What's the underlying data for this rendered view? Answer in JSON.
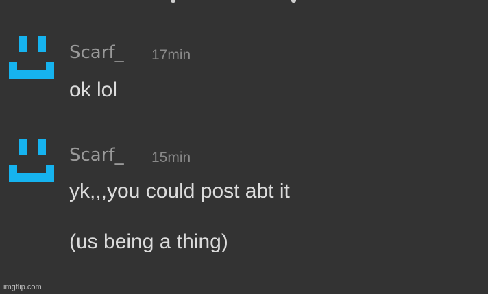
{
  "colors": {
    "background": "#333333",
    "avatar": "#16b3ef",
    "username": "#9a9a9a",
    "timestamp": "#8a8a8a",
    "message_text": "#dcdcdc"
  },
  "messages": [
    {
      "avatar_icon": "smiley-pixel-avatar-icon",
      "username": "Scarf_",
      "time": "17min",
      "lines": [
        "ok lol"
      ]
    },
    {
      "avatar_icon": "smiley-pixel-avatar-icon",
      "username": "Scarf_",
      "time": "15min",
      "lines": [
        "yk,,,you could post abt it",
        "(us being a thing)"
      ]
    }
  ],
  "watermark": "imgflip.com"
}
